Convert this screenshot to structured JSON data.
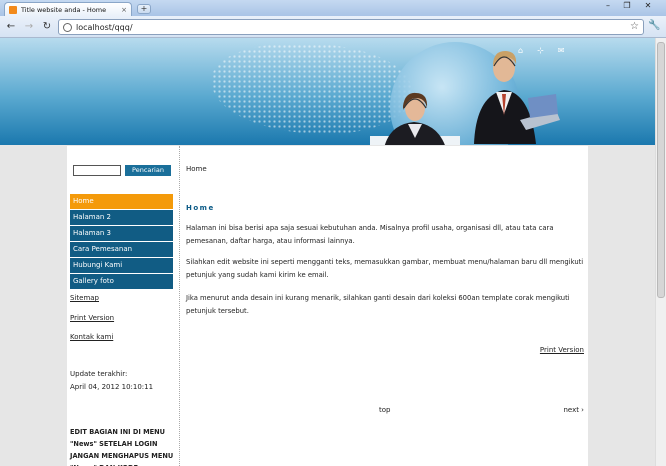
{
  "browser": {
    "tab_title": "Title website anda - Home",
    "tab_close": "×",
    "new_tab": "+",
    "url": "localhost/qqq/",
    "back": "←",
    "forward": "→",
    "reload": "↻",
    "star": "☆",
    "wrench": "🔧",
    "minimize": "–",
    "restore": "❐",
    "close": "✕"
  },
  "header": {
    "icon_home": "⌂",
    "icon_sitemap": "⊹",
    "icon_mail": "✉"
  },
  "sidebar": {
    "search_button": "Pencarian",
    "search_placeholder": "",
    "menu": [
      {
        "label": "Home",
        "active": true
      },
      {
        "label": "Halaman 2",
        "active": false
      },
      {
        "label": "Halaman 3",
        "active": false
      },
      {
        "label": "Cara Pemesanan",
        "active": false
      },
      {
        "label": "Hubungi Kami",
        "active": false
      },
      {
        "label": "Gallery foto",
        "active": false
      }
    ],
    "links": {
      "sitemap": "Sitemap",
      "print": "Print Version",
      "contact": "Kontak kami"
    },
    "update_label": "Update terakhir:",
    "update_date": "April 04, 2012 10:10:11",
    "news_note": "EDIT BAGIAN INI DI MENU \"News\" SETELAH LOGIN JANGAN MENGHAPUS MENU \"News\" DAN KODE"
  },
  "content": {
    "breadcrumb": "Home",
    "title": "Home",
    "para1": "Halaman ini bisa berisi apa saja sesuai kebutuhan anda. Misalnya profil usaha, organisasi dll, atau tata cara pemesanan, daftar harga, atau informasi lainnya.",
    "para2": "Silahkan edit website ini seperti mengganti teks, memasukkan gambar, membuat menu/halaman baru dll mengikuti petunjuk yang sudah kami kirim ke email.",
    "para3": "Jika menurut anda desain ini kurang menarik, silahkan ganti desain dari koleksi 600an template corak mengikuti petunjuk tersebut.",
    "print_version": "Print Version",
    "top": "top",
    "next": "next ›"
  },
  "colors": {
    "menu_blue": "#115c84",
    "menu_active": "#f49a0a",
    "title_blue": "#0b5a86"
  }
}
